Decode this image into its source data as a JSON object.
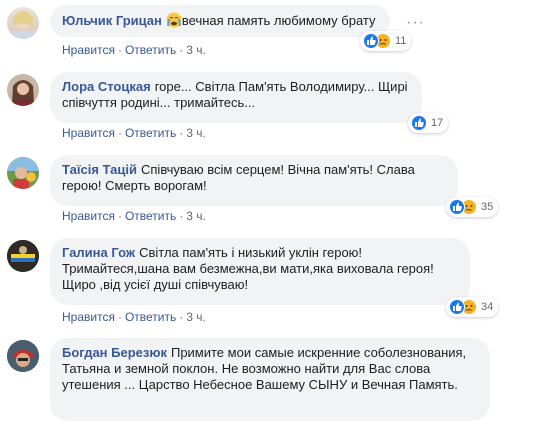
{
  "actions": {
    "like": "Нравится",
    "reply": "Ответить",
    "separator": "·"
  },
  "comments": [
    {
      "author": "Юльчик Грицан",
      "text": "вечная память любимому брату",
      "emoji": "crying-face",
      "time": "3 ч.",
      "reactions": {
        "count": "11",
        "types": [
          "like",
          "sad"
        ]
      },
      "more_menu": "···"
    },
    {
      "author": "Лора Стоцкая",
      "text": "горе... Світла Пам'ять Володимиру... Щирі співчуття родині... тримайтесь...",
      "time": "3 ч.",
      "reactions": {
        "count": "17",
        "types": [
          "like"
        ]
      }
    },
    {
      "author": "Таїсія Тацій",
      "text": "Співчуваю всім серцем! Вічна пам'ять! Слава герою! Смерть ворогам!",
      "time": "3 ч.",
      "reactions": {
        "count": "35",
        "types": [
          "like",
          "sad"
        ]
      }
    },
    {
      "author": "Галина Гож",
      "text": "Світла пам'ять і низький уклін герою! Тримайтеся,шана вам безмежна,ви мати,яка виховала героя! Щиро ,від усієї душі співчуваю!",
      "time": "3 ч.",
      "reactions": {
        "count": "34",
        "types": [
          "like",
          "sad"
        ]
      }
    },
    {
      "author": "Богдан Березюк",
      "text": "Примите мои самые искренние соболезнования, Татьяна и земной поклон. Не возможно найти для Вас слова утешения ... Царство Небесное Вашему СЫНУ и Вечная Память."
    }
  ],
  "colors": {
    "author": "#385898",
    "bubble": "#f2f3f5",
    "like": "#1877f2",
    "sad": "#f7b125"
  }
}
